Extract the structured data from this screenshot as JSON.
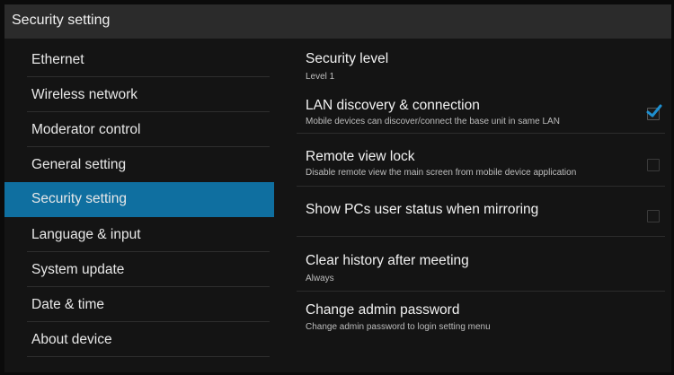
{
  "header": {
    "title": "Security setting"
  },
  "sidebar": {
    "items": [
      {
        "label": "Ethernet",
        "active": false
      },
      {
        "label": "Wireless network",
        "active": false
      },
      {
        "label": "Moderator control",
        "active": false
      },
      {
        "label": "General setting",
        "active": false
      },
      {
        "label": "Security setting",
        "active": true
      },
      {
        "label": "Language & input",
        "active": false
      },
      {
        "label": "System update",
        "active": false
      },
      {
        "label": "Date & time",
        "active": false
      },
      {
        "label": "About device",
        "active": false
      }
    ]
  },
  "settings": [
    {
      "title": "Security level",
      "subtitle": "Level 1"
    },
    {
      "title": "LAN discovery & connection",
      "subtitle": "Mobile devices can discover/connect the base unit in same LAN",
      "checked": true
    },
    {
      "title": "Remote view lock",
      "subtitle": "Disable remote view the main screen from mobile device application",
      "checked": false
    },
    {
      "title": "Show PCs user status when mirroring",
      "checked": false
    },
    {
      "title": "Clear history after meeting",
      "subtitle": "Always"
    },
    {
      "title": "Change admin password",
      "subtitle": "Change admin password to login setting menu"
    }
  ],
  "colors": {
    "accent": "#0f6fa0",
    "check": "#1e8fd0"
  }
}
